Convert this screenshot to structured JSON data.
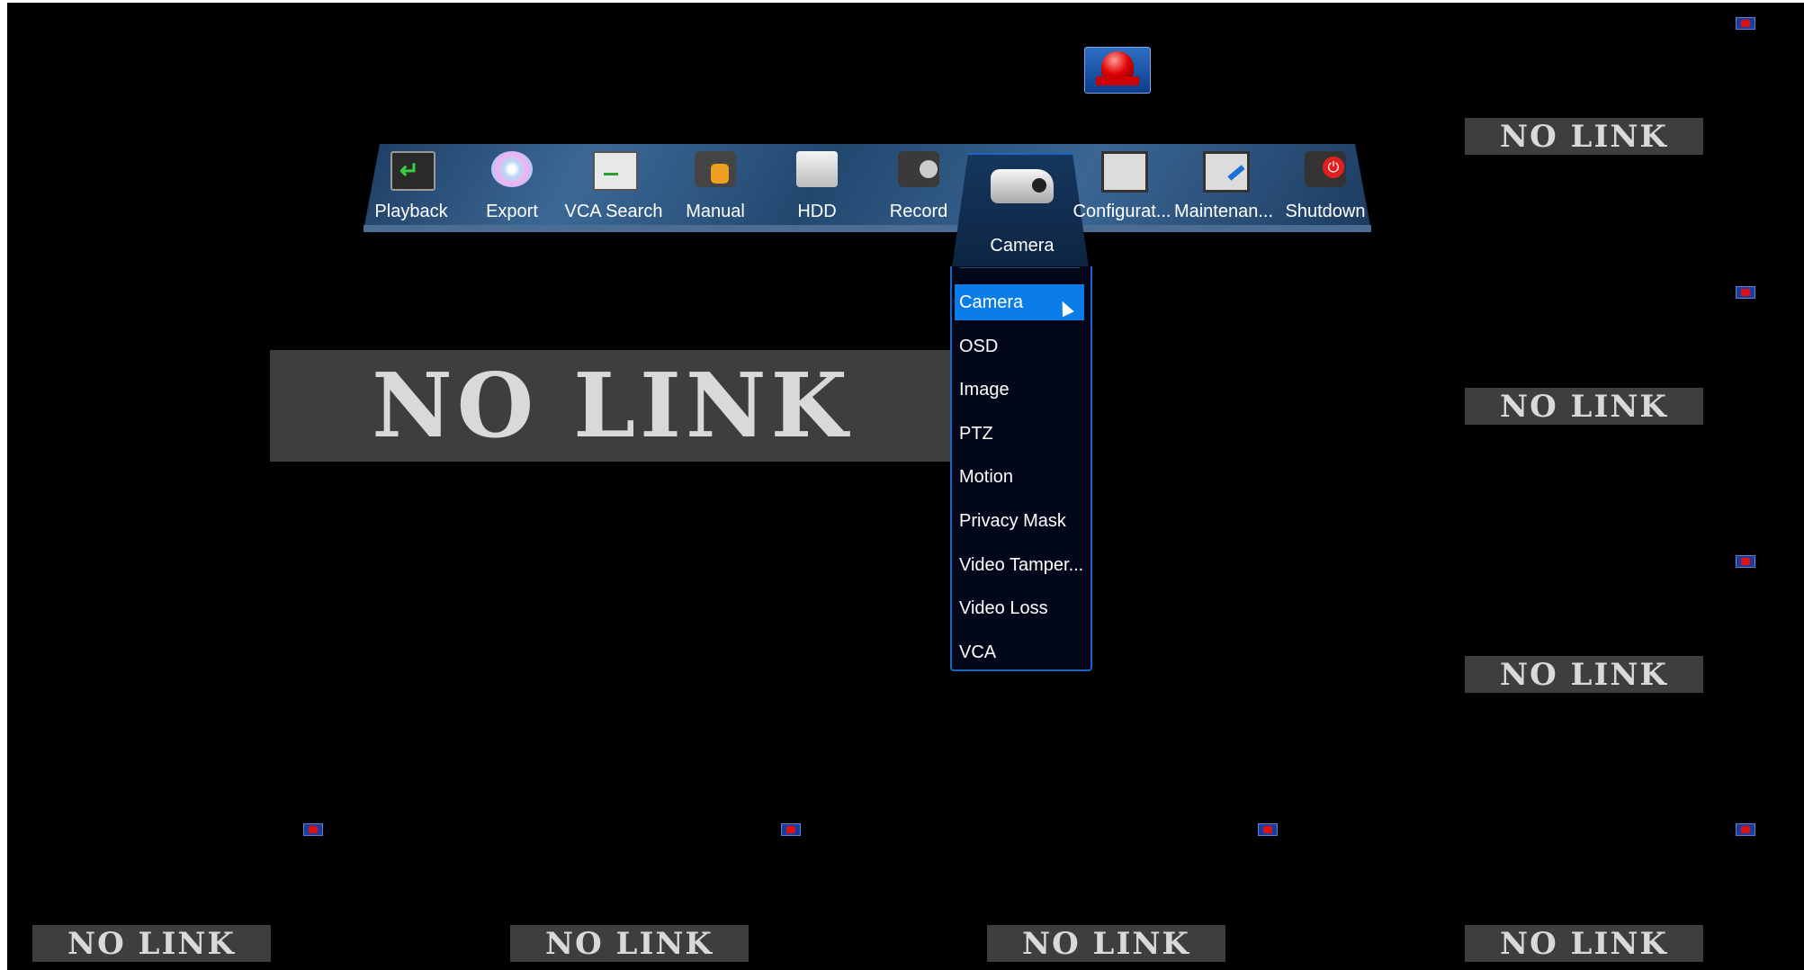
{
  "status": {
    "no_link": "NO LINK"
  },
  "menubar": {
    "items": [
      {
        "label": "Playback"
      },
      {
        "label": "Export"
      },
      {
        "label": "VCA Search"
      },
      {
        "label": "Manual"
      },
      {
        "label": "HDD"
      },
      {
        "label": "Record"
      },
      {
        "label": "Camera"
      },
      {
        "label": "Configurat..."
      },
      {
        "label": "Maintenan..."
      },
      {
        "label": "Shutdown"
      }
    ]
  },
  "camera_menu": {
    "title": "Camera",
    "items": [
      {
        "label": "Camera",
        "selected": true
      },
      {
        "label": "OSD"
      },
      {
        "label": "Image"
      },
      {
        "label": "PTZ"
      },
      {
        "label": "Motion"
      },
      {
        "label": "Privacy Mask"
      },
      {
        "label": "Video Tamper..."
      },
      {
        "label": "Video Loss"
      },
      {
        "label": "VCA"
      }
    ]
  },
  "icons": {
    "alarm": "alarm-light-icon",
    "record_indicator": "record-indicator-icon"
  },
  "colors": {
    "accent": "#0a7de8",
    "menu_border": "#1a66c2",
    "background": "#000000"
  }
}
